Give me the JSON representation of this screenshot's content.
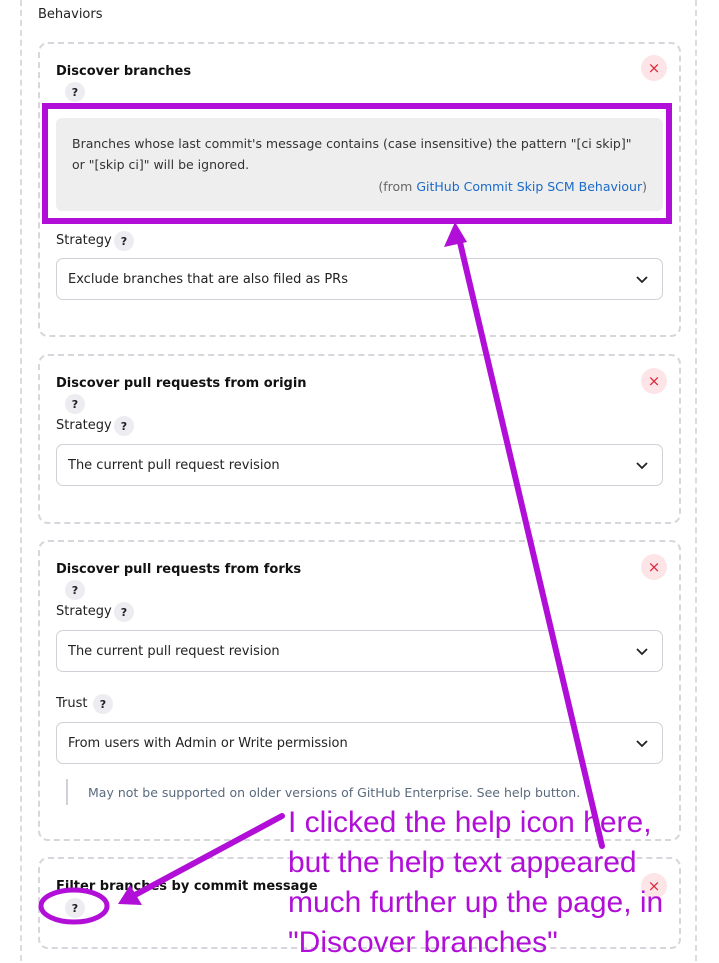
{
  "section_title": "Behaviors",
  "help_glyph": "?",
  "close_glyph": "×",
  "cards": {
    "discover_branches": {
      "title": "Discover branches",
      "help_text": "Branches whose last commit's message contains (case insensitive) the pattern \"[ci skip]\" or \"[skip ci]\" will be ignored.",
      "help_from_prefix": "(from ",
      "help_from_link": "GitHub Commit Skip SCM Behaviour",
      "help_from_suffix": ")",
      "strategy_label": "Strategy",
      "strategy_value": "Exclude branches that are also filed as PRs"
    },
    "discover_prs_origin": {
      "title": "Discover pull requests from origin",
      "strategy_label": "Strategy",
      "strategy_value": "The current pull request revision"
    },
    "discover_prs_forks": {
      "title": "Discover pull requests from forks",
      "strategy_label": "Strategy",
      "strategy_value": "The current pull request revision",
      "trust_label": "Trust",
      "trust_value": "From users with Admin or Write permission",
      "trust_note": "May not be supported on older versions of GitHub Enterprise. See help button."
    },
    "filter_branches_commit": {
      "title": "Filter branches by commit message"
    }
  },
  "annotation": {
    "text": "I clicked the help icon here,\nbut the help text appeared\nmuch further up the page, in\n\"Discover branches\"",
    "color": "#b10fd8"
  },
  "colors": {
    "accent_link": "#1b6ac9",
    "close_red": "#e0263a",
    "annotation_purple": "#b10fd8"
  }
}
